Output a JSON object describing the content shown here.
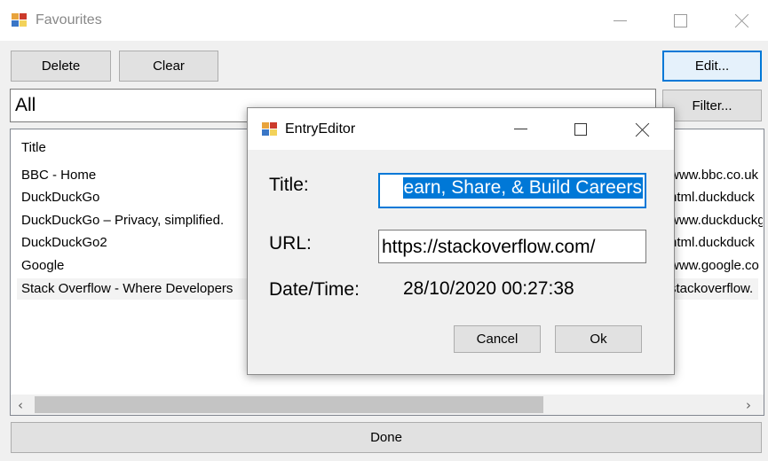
{
  "window": {
    "title": "Favourites"
  },
  "toolbar": {
    "delete_label": "Delete",
    "clear_label": "Clear",
    "edit_label": "Edit...",
    "filter_label": "Filter..."
  },
  "filter_combo": {
    "value": "All"
  },
  "list": {
    "column_title": "Title",
    "rows": [
      {
        "title": "BBC - Home",
        "url": "www.bbc.co.uk"
      },
      {
        "title": "DuckDuckGo",
        "url": "html.duckduck"
      },
      {
        "title": "DuckDuckGo – Privacy, simplified.",
        "url": "www.duckduckg"
      },
      {
        "title": "DuckDuckGo2",
        "url": "html.duckduck"
      },
      {
        "title": "Google",
        "url": "www.google.co"
      },
      {
        "title": "Stack Overflow - Where Developers",
        "url": "stackoverflow."
      }
    ],
    "selected_index": 5
  },
  "footer": {
    "done_label": "Done"
  },
  "dialog": {
    "title": "EntryEditor",
    "title_label": "Title:",
    "title_value": "earn, Share, & Build Careers",
    "url_label": "URL:",
    "url_value": "https://stackoverflow.com/",
    "datetime_label": "Date/Time:",
    "datetime_value": "28/10/2020 00:27:38",
    "cancel_label": "Cancel",
    "ok_label": "Ok"
  },
  "colors": {
    "accent": "#0078d7",
    "selection_bg": "#0078d7",
    "window_bg": "#f0f0f0"
  }
}
